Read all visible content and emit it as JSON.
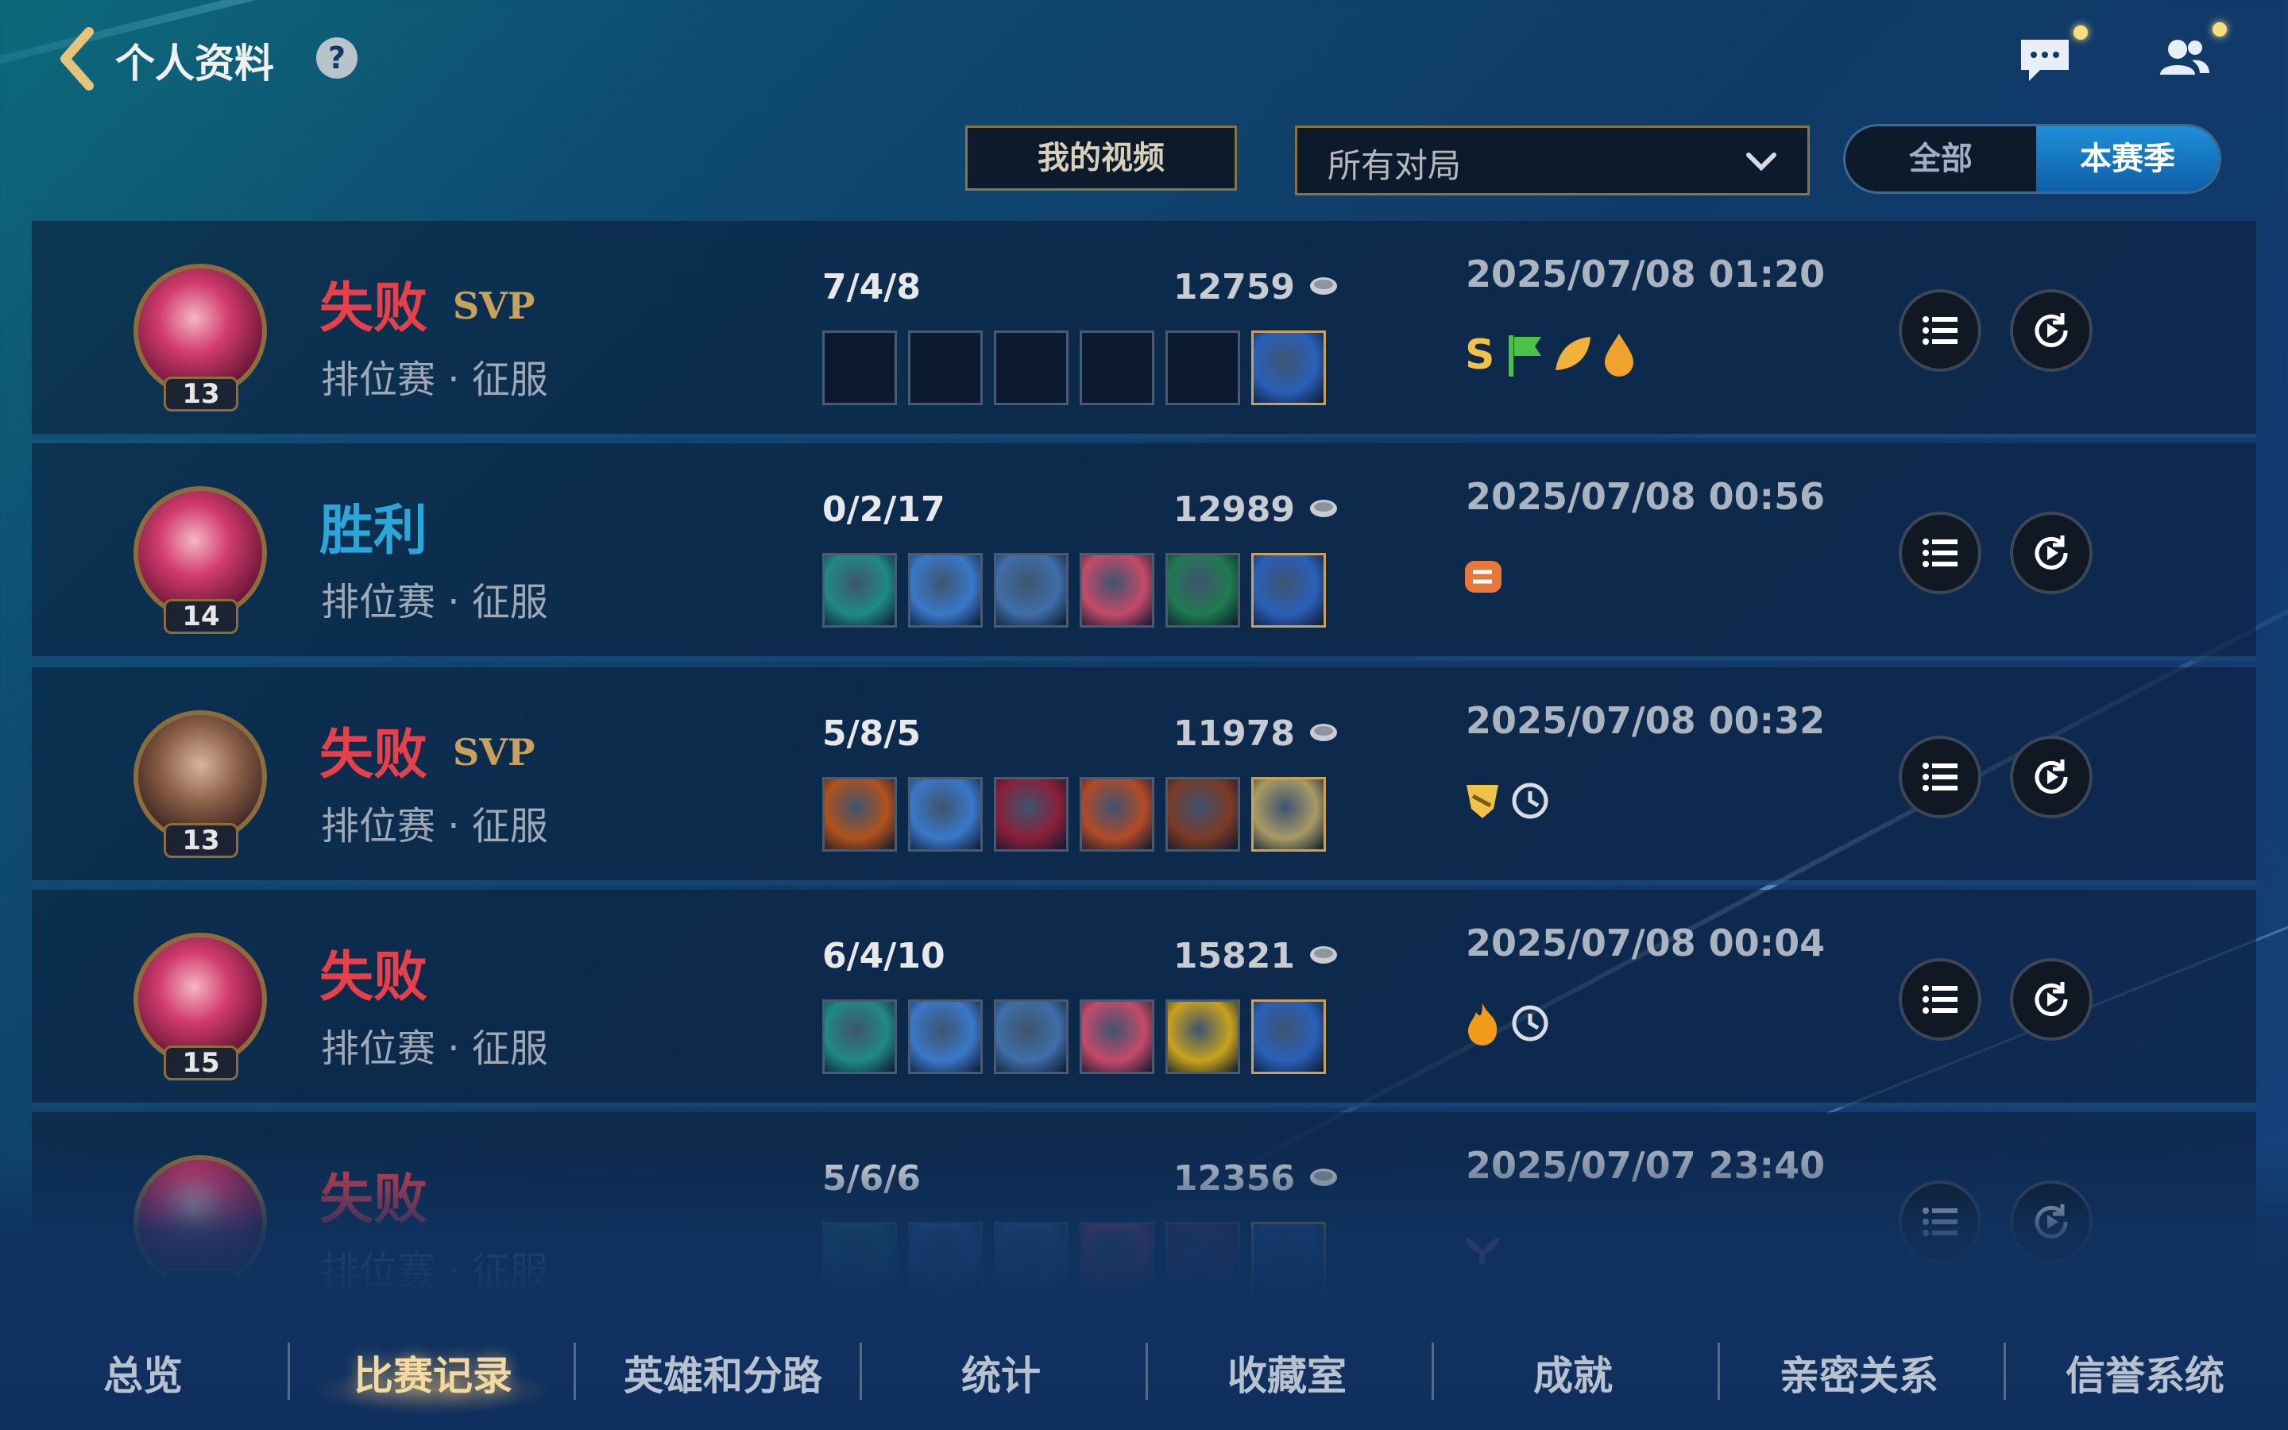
{
  "header": {
    "title": "个人资料",
    "help": "?"
  },
  "filters": {
    "video_button": "我的视频",
    "match_type_selected": "所有对局",
    "season_toggle": [
      "全部",
      "本赛季"
    ],
    "season_active": "本赛季"
  },
  "matches": [
    {
      "result": "失败",
      "svp": "SVP",
      "mode": "排位赛 · 征服",
      "level": "13",
      "kda": "7/4/8",
      "gold": "12759",
      "date": "2025/07/08 01:20",
      "badges": [
        "S-icon",
        "flag-icon",
        "leaf-icon",
        "drop-icon"
      ]
    },
    {
      "result": "胜利",
      "svp": "",
      "mode": "排位赛 · 征服",
      "level": "14",
      "kda": "0/2/17",
      "gold": "12989",
      "date": "2025/07/08 00:56",
      "badges": [
        "link-icon"
      ]
    },
    {
      "result": "失败",
      "svp": "SVP",
      "mode": "排位赛 · 征服",
      "level": "13",
      "kda": "5/8/5",
      "gold": "11978",
      "date": "2025/07/08 00:32",
      "badges": [
        "shield-icon",
        "clock-icon"
      ]
    },
    {
      "result": "失败",
      "svp": "",
      "mode": "排位赛 · 征服",
      "level": "15",
      "kda": "6/4/10",
      "gold": "15821",
      "date": "2025/07/08 00:04",
      "badges": [
        "fire-icon",
        "clock-icon"
      ]
    },
    {
      "result": "失败",
      "svp": "",
      "mode": "排位赛 · 征服",
      "level": "",
      "kda": "5/6/6",
      "gold": "12356",
      "date": "2025/07/07 23:40",
      "badges": [
        "angel-icon"
      ]
    }
  ],
  "tabs": [
    "总览",
    "比赛记录",
    "英雄和分路",
    "统计",
    "收藏室",
    "成就",
    "亲密关系",
    "信誉系统"
  ],
  "active_tab": "比赛记录",
  "colors": {
    "lose": "#e8404a",
    "win": "#2aa6d8",
    "accent_gold": "#c9a15a"
  }
}
